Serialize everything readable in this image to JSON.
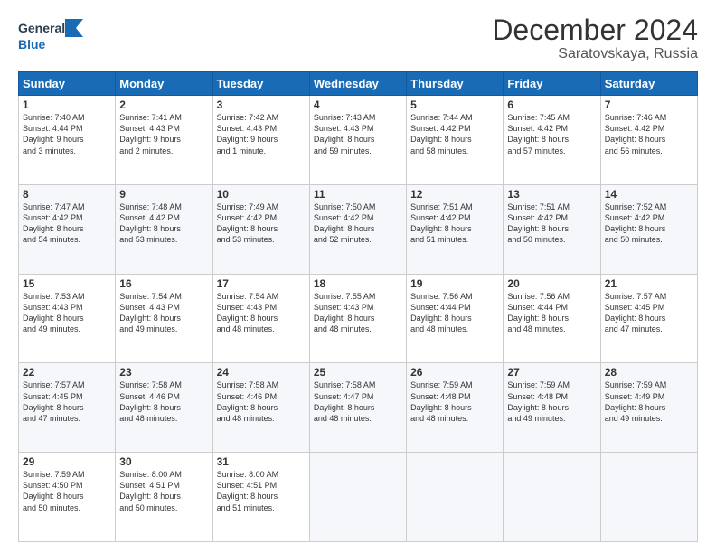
{
  "header": {
    "logo_general": "General",
    "logo_blue": "Blue",
    "title": "December 2024",
    "subtitle": "Saratovskaya, Russia"
  },
  "calendar": {
    "days": [
      "Sunday",
      "Monday",
      "Tuesday",
      "Wednesday",
      "Thursday",
      "Friday",
      "Saturday"
    ],
    "weeks": [
      [
        {
          "day": "1",
          "text": "Sunrise: 7:40 AM\nSunset: 4:44 PM\nDaylight: 9 hours\nand 3 minutes."
        },
        {
          "day": "2",
          "text": "Sunrise: 7:41 AM\nSunset: 4:43 PM\nDaylight: 9 hours\nand 2 minutes."
        },
        {
          "day": "3",
          "text": "Sunrise: 7:42 AM\nSunset: 4:43 PM\nDaylight: 9 hours\nand 1 minute."
        },
        {
          "day": "4",
          "text": "Sunrise: 7:43 AM\nSunset: 4:43 PM\nDaylight: 8 hours\nand 59 minutes."
        },
        {
          "day": "5",
          "text": "Sunrise: 7:44 AM\nSunset: 4:42 PM\nDaylight: 8 hours\nand 58 minutes."
        },
        {
          "day": "6",
          "text": "Sunrise: 7:45 AM\nSunset: 4:42 PM\nDaylight: 8 hours\nand 57 minutes."
        },
        {
          "day": "7",
          "text": "Sunrise: 7:46 AM\nSunset: 4:42 PM\nDaylight: 8 hours\nand 56 minutes."
        }
      ],
      [
        {
          "day": "8",
          "text": "Sunrise: 7:47 AM\nSunset: 4:42 PM\nDaylight: 8 hours\nand 54 minutes."
        },
        {
          "day": "9",
          "text": "Sunrise: 7:48 AM\nSunset: 4:42 PM\nDaylight: 8 hours\nand 53 minutes."
        },
        {
          "day": "10",
          "text": "Sunrise: 7:49 AM\nSunset: 4:42 PM\nDaylight: 8 hours\nand 53 minutes."
        },
        {
          "day": "11",
          "text": "Sunrise: 7:50 AM\nSunset: 4:42 PM\nDaylight: 8 hours\nand 52 minutes."
        },
        {
          "day": "12",
          "text": "Sunrise: 7:51 AM\nSunset: 4:42 PM\nDaylight: 8 hours\nand 51 minutes."
        },
        {
          "day": "13",
          "text": "Sunrise: 7:51 AM\nSunset: 4:42 PM\nDaylight: 8 hours\nand 50 minutes."
        },
        {
          "day": "14",
          "text": "Sunrise: 7:52 AM\nSunset: 4:42 PM\nDaylight: 8 hours\nand 50 minutes."
        }
      ],
      [
        {
          "day": "15",
          "text": "Sunrise: 7:53 AM\nSunset: 4:43 PM\nDaylight: 8 hours\nand 49 minutes."
        },
        {
          "day": "16",
          "text": "Sunrise: 7:54 AM\nSunset: 4:43 PM\nDaylight: 8 hours\nand 49 minutes."
        },
        {
          "day": "17",
          "text": "Sunrise: 7:54 AM\nSunset: 4:43 PM\nDaylight: 8 hours\nand 48 minutes."
        },
        {
          "day": "18",
          "text": "Sunrise: 7:55 AM\nSunset: 4:43 PM\nDaylight: 8 hours\nand 48 minutes."
        },
        {
          "day": "19",
          "text": "Sunrise: 7:56 AM\nSunset: 4:44 PM\nDaylight: 8 hours\nand 48 minutes."
        },
        {
          "day": "20",
          "text": "Sunrise: 7:56 AM\nSunset: 4:44 PM\nDaylight: 8 hours\nand 48 minutes."
        },
        {
          "day": "21",
          "text": "Sunrise: 7:57 AM\nSunset: 4:45 PM\nDaylight: 8 hours\nand 47 minutes."
        }
      ],
      [
        {
          "day": "22",
          "text": "Sunrise: 7:57 AM\nSunset: 4:45 PM\nDaylight: 8 hours\nand 47 minutes."
        },
        {
          "day": "23",
          "text": "Sunrise: 7:58 AM\nSunset: 4:46 PM\nDaylight: 8 hours\nand 48 minutes."
        },
        {
          "day": "24",
          "text": "Sunrise: 7:58 AM\nSunset: 4:46 PM\nDaylight: 8 hours\nand 48 minutes."
        },
        {
          "day": "25",
          "text": "Sunrise: 7:58 AM\nSunset: 4:47 PM\nDaylight: 8 hours\nand 48 minutes."
        },
        {
          "day": "26",
          "text": "Sunrise: 7:59 AM\nSunset: 4:48 PM\nDaylight: 8 hours\nand 48 minutes."
        },
        {
          "day": "27",
          "text": "Sunrise: 7:59 AM\nSunset: 4:48 PM\nDaylight: 8 hours\nand 49 minutes."
        },
        {
          "day": "28",
          "text": "Sunrise: 7:59 AM\nSunset: 4:49 PM\nDaylight: 8 hours\nand 49 minutes."
        }
      ],
      [
        {
          "day": "29",
          "text": "Sunrise: 7:59 AM\nSunset: 4:50 PM\nDaylight: 8 hours\nand 50 minutes."
        },
        {
          "day": "30",
          "text": "Sunrise: 8:00 AM\nSunset: 4:51 PM\nDaylight: 8 hours\nand 50 minutes."
        },
        {
          "day": "31",
          "text": "Sunrise: 8:00 AM\nSunset: 4:51 PM\nDaylight: 8 hours\nand 51 minutes."
        },
        {
          "day": "",
          "text": ""
        },
        {
          "day": "",
          "text": ""
        },
        {
          "day": "",
          "text": ""
        },
        {
          "day": "",
          "text": ""
        }
      ]
    ]
  }
}
